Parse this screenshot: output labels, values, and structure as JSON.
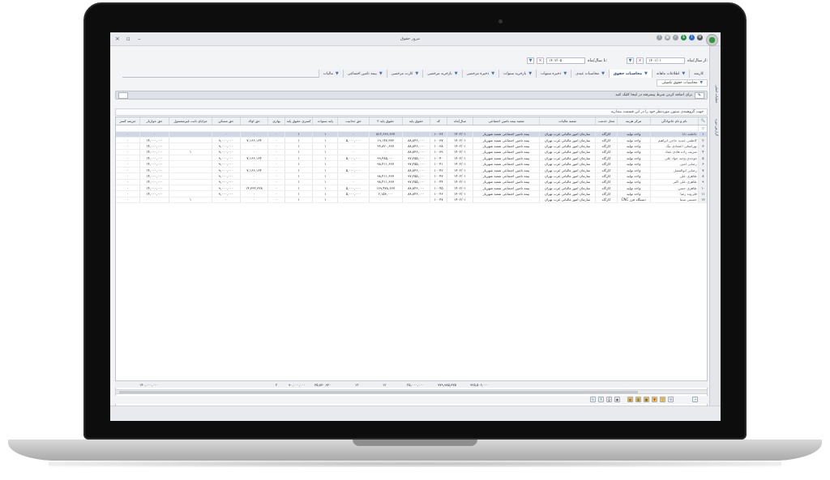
{
  "window": {
    "title": "مرور حقوق",
    "controls": [
      "×",
      "▫",
      "–"
    ]
  },
  "side_nav": {
    "items": [
      "عملیات اصلی",
      "گزارش دوره"
    ]
  },
  "filter": {
    "from_label": "از سال/ماه:",
    "from_value": "۱۴۰۱/۰۱",
    "to_label": "تا سال/ماه:",
    "to_value": "۱۴۰۲/۰۵"
  },
  "tabs": [
    {
      "label": "کارمند",
      "active": false
    },
    {
      "label": "اطلاعات ماهانه",
      "active": false
    },
    {
      "label": "محاسبات حقوق",
      "active": true
    },
    {
      "label": "محاسبات عیدی",
      "active": false
    },
    {
      "label": "ذخیره سنوات",
      "active": false
    },
    {
      "label": "بازخرید سنوات",
      "active": false
    },
    {
      "label": "ذخیره مرخصی",
      "active": false
    },
    {
      "label": "بازخرید مرخصی",
      "active": false
    },
    {
      "label": "کارت مرخصی",
      "active": false
    },
    {
      "label": "بیمه تامین اجتماعی",
      "active": false
    },
    {
      "label": "مالیات",
      "active": false
    }
  ],
  "subtab": {
    "label": "محاسبات حقوق تکمیلی"
  },
  "condition_bar": {
    "text": "برای اضافه کردن شرط پیشرفته در اینجا کلیک کنید"
  },
  "group_hint": "جهت گروهبندی ستون موردنظر خود را در این قسمت بیندازید",
  "grid": {
    "columns": [
      "",
      "نام و نام خانوادگی",
      "مرکز هزینه",
      "محل خدمت",
      "شعبه مالیات",
      "شعبه بیمه تامین اجتماعی",
      "سال/ماه",
      "کد",
      "حقوق پایه",
      "حقوق پایه ۲",
      "حق جذابیت",
      "پایه سنوات",
      "کسری حقوق پایه",
      "بهاری",
      "حق اولاد",
      "حق مسکن",
      "مزایای ثابت غیرمشمول",
      "حق خواربار",
      "جریمه کسر"
    ],
    "rows": [
      [
        "۱",
        "عاطفه دانا",
        "واحد تولید",
        "کارگاه",
        "سازمان امور مالیاتی غرب تهران",
        "بیمه تامین اجتماعی شعبه شهریار",
        "۱۴۰۲/۰۱",
        "۱۰۰۳۶",
        "۰",
        "۵۱۲,۶۶۶,۶۶۷",
        "۰",
        "۱",
        "۱",
        "۰",
        "۰",
        "۰",
        "",
        "۰",
        "۰"
      ],
      [
        "۲",
        "کاظمی عبدیه حاجی ابراهیم",
        "واحد تولید",
        "کارگاه",
        "سازمان امور مالیاتی غرب تهران",
        "بیمه تامین اجتماعی شعبه شهریار",
        "۱۴۰۲/۰۱",
        "۱۰۰۳۷",
        "۸۸,۸۴۶,۰۰۰",
        "۱۹,۱۴۷,۳۳۳",
        "۵,۰۰۰,۰۰۰",
        "۱",
        "۱",
        "۰",
        "۷,۱۶۶,۱۶۴",
        "۹,۰۰۰,۰۰۰",
        "",
        "۱۴,۰۰۰,۰۰۰",
        "۰"
      ],
      [
        "۳",
        "بهرامعلی اعتمادی بیگ",
        "واحد تولید",
        "کارگاه",
        "سازمان امور مالیاتی غرب تهران",
        "بیمه تامین اجتماعی شعبه شهریار",
        "۱۴۰۲/۰۱",
        "۱۰۰۳۸",
        "۸۸,۸۴۶,۰۰۰",
        "۲۳,۸۲۰,۶۶۷",
        "۰",
        "۱",
        "۱",
        "۰",
        "۰",
        "۹,۰۰۰,۰۰۰",
        "",
        "۱۴,۰۰۰,۰۰۰",
        "۰"
      ],
      [
        "۴",
        "شریف زاده هادی عماد",
        "واحد تولید",
        "کارگاه",
        "سازمان امور مالیاتی غرب تهران",
        "بیمه تامین اجتماعی شعبه شهریار",
        "۱۴۰۲/۰۱",
        "۱۰۰۳۹",
        "۸۸,۸۴۶,۰۰۰",
        "۰",
        "۰",
        "۱",
        "۱",
        "۰",
        "۰",
        "۹,۰۰۰,۰۰۰",
        "۱",
        "۱۴,۰۰۰,۰۰۰",
        "۰"
      ],
      [
        "۵",
        "موحدی وحید جواد علی",
        "واحد تولید",
        "کارگاه",
        "سازمان امور مالیاتی غرب تهران",
        "بیمه تامین اجتماعی شعبه شهریار",
        "۱۴۰۲/۰۱",
        "۱۰۰۴۰",
        "۹۷,۲۵۵,۰۰۰",
        "۹۹,۴۸۵,۰۰۰",
        "۵,۰۰۰,۰۰۰",
        "۱",
        "۱",
        "۰",
        "۷,۱۶۶,۱۶۴",
        "۹,۰۰۰,۰۰۰",
        "",
        "۱۴,۰۰۰,۰۰۰",
        "۰"
      ],
      [
        "۶",
        "رضایی امین",
        "واحد تولید",
        "کارگاه",
        "سازمان امور مالیاتی غرب تهران",
        "بیمه تامین اجتماعی شعبه شهریار",
        "۱۴۰۲/۰۱",
        "۱۰۰۴۱",
        "۹۷,۲۵۵,۰۰۰",
        "۹۸,۴۱۱,۶۶۷",
        "۰",
        "۱",
        "۱",
        "۰",
        "۰",
        "۹,۰۰۰,۰۰۰",
        "",
        "۱۴,۰۰۰,۰۰۰",
        "۰"
      ],
      [
        "۷",
        "رضایی ابوالفضل",
        "واحد تولید",
        "کارگاه",
        "سازمان امور مالیاتی غرب تهران",
        "بیمه تامین اجتماعی شعبه شهریار",
        "۱۴۰۲/۰۱",
        "۱۰۰۴۲",
        "۸۸,۸۴۶,۰۰۰",
        "۰",
        "۵,۰۰۰,۰۰۰",
        "۱",
        "۱",
        "۰",
        "۷,۱۶۶,۱۶۴",
        "۹,۰۰۰,۰۰۰",
        "",
        "۱۴,۰۰۰,۰۰۰",
        "۰"
      ],
      [
        "۸",
        "طاهری علی",
        "واحد تولید",
        "کارگاه",
        "سازمان امور مالیاتی غرب تهران",
        "بیمه تامین اجتماعی شعبه شهریار",
        "۱۴۰۲/۰۱",
        "۱۰۰۴۳",
        "۹۷,۲۵۵,۰۰۰",
        "۹۸,۴۱۱,۶۶۷",
        "۰",
        "۱",
        "۱",
        "۰",
        "۰",
        "۹,۰۰۰,۰۰۰",
        "",
        "۱۴,۰۰۰,۰۰۰",
        "۰"
      ],
      [
        "۹",
        "طاهری علی اکبر",
        "واحد تولید",
        "کارگاه",
        "سازمان امور مالیاتی غرب تهران",
        "بیمه تامین اجتماعی شعبه شهریار",
        "۱۴۰۲/۰۱",
        "۱۰۰۴۴",
        "۹۷,۲۵۵,۰۰۰",
        "۹۸,۴۱۱,۶۶۷",
        "۰",
        "۱",
        "۱",
        "۰",
        "۰",
        "۹,۰۰۰,۰۰۰",
        "",
        "۱۴,۰۰۰,۰۰۰",
        "۰"
      ],
      [
        "۱۰",
        "طاهری حسن",
        "واحد تولید",
        "کارگاه",
        "سازمان امور مالیاتی غرب تهران",
        "بیمه تامین اجتماعی شعبه شهریار",
        "۱۴۰۲/۰۱",
        "۱۰۰۴۵",
        "۸۸,۸۴۶,۰۰۰",
        "۱۶۹,۴۷۸,۶۶۷",
        "۵,۰۰۰,۰۰۰",
        "۱",
        "۱",
        "۰",
        "۱۴,۳۳۲,۳۲۸",
        "۹,۰۰۰,۰۰۰",
        "",
        "۱۴,۰۰۰,۰۰۰",
        "۰"
      ],
      [
        "۱۱",
        "قلی‌وند رضا",
        "واحد تولید",
        "کارگاه",
        "سازمان امور مالیاتی غرب تهران",
        "بیمه تامین اجتماعی شعبه شهریار",
        "۱۴۰۲/۰۱",
        "۱۰۰۴۶",
        "۸۸,۸۴۶,۰۰۰",
        "۲,۱۵۳,۰۰۰",
        "۵,۰۰۰,۰۰۰",
        "۱",
        "۱",
        "۰",
        "۰",
        "۹,۰۰۰,۰۰۰",
        "",
        "۱۴,۰۰۰,۰۰۰",
        "۰"
      ],
      [
        "۱۲",
        "حسینی سینا",
        "دستگاه فرز CNC",
        "کارگاه",
        "سازمان امور مالیاتی غرب تهران",
        "",
        "۱۴۰۲/۰۱",
        "۱۰۰۴۷",
        "",
        "",
        "",
        "۱",
        "۱",
        "۰",
        "۰",
        "۰",
        "۱",
        "",
        "۰"
      ]
    ]
  },
  "totals": {
    "base_salary": "۹۲۵,۵۰۶,۰۰۰",
    "base_salary2": "۹۷۹,۹۸۵,۳۳۵",
    "attraction": "۲۵,۰۰۰,۰۰۰",
    "seniority": "۱۲",
    "deduction": "۱۲",
    "child": "۳۵,۸۳۰,۹۲۰",
    "housing": "۹۰,۰۰۰,۰۰۰",
    "fixed": "۲",
    "grocery": "۱۴۰,۰۰۰,۰۰۰"
  }
}
